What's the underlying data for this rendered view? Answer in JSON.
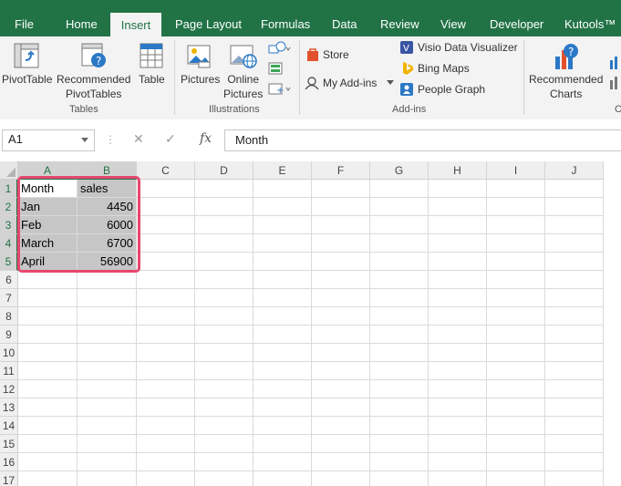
{
  "tabs": [
    {
      "label": "File"
    },
    {
      "label": "Home"
    },
    {
      "label": "Insert"
    },
    {
      "label": "Page Layout"
    },
    {
      "label": "Formulas"
    },
    {
      "label": "Data"
    },
    {
      "label": "Review"
    },
    {
      "label": "View"
    },
    {
      "label": "Developer"
    },
    {
      "label": "Kutools™"
    }
  ],
  "ribbon": {
    "pivottable": "PivotTable",
    "recommended_pivot_l1": "Recommended",
    "recommended_pivot_l2": "PivotTables",
    "table": "Table",
    "group_tables": "Tables",
    "pictures": "Pictures",
    "online_l1": "Online",
    "online_l2": "Pictures",
    "group_illustrations": "Illustrations",
    "store": "Store",
    "my_addins": "My Add-ins",
    "visio": "Visio Data Visualizer",
    "bing_maps": "Bing Maps",
    "people_graph": "People Graph",
    "group_addins": "Add-ins",
    "rec_charts_l1": "Recommended",
    "rec_charts_l2": "Charts",
    "group_partial": "C"
  },
  "formula_bar": {
    "name_box": "A1",
    "cancel": "✕",
    "enter": "✓",
    "fx": "fx",
    "content": "Month"
  },
  "columns": [
    "A",
    "B",
    "C",
    "D",
    "E",
    "F",
    "G",
    "H",
    "I",
    "J"
  ],
  "rows": [
    "1",
    "2",
    "3",
    "4",
    "5",
    "6",
    "7",
    "8",
    "9",
    "10",
    "11",
    "12",
    "13",
    "14",
    "15",
    "16",
    "17"
  ],
  "table": {
    "headers": [
      "Month",
      "sales"
    ],
    "rows": [
      [
        "Jan",
        "4450"
      ],
      [
        "Feb",
        "6000"
      ],
      [
        "March",
        "6700"
      ],
      [
        "April",
        "56900"
      ]
    ]
  },
  "colors": {
    "excel_green": "#217346",
    "selection_highlight": "#e6476f",
    "selection_fill": "#c6c6c6"
  }
}
